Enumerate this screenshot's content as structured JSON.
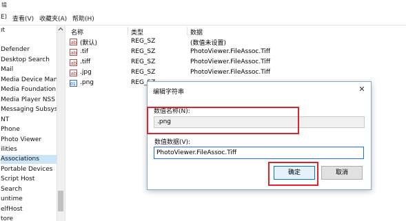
{
  "menubar": {
    "top_fragment": "辑",
    "items": [
      "E)",
      "查看(V)",
      "收藏夹(A)",
      "帮助(H)"
    ]
  },
  "tree": {
    "items": [
      {
        "label": "ıt",
        "selected": false
      },
      {
        "label": "Defender",
        "selected": false
      },
      {
        "label": "Desktop Search",
        "selected": false
      },
      {
        "label": "Mail",
        "selected": false
      },
      {
        "label": "Media Device Mana",
        "selected": false
      },
      {
        "label": "Media Foundation",
        "selected": false
      },
      {
        "label": "Media Player NSS",
        "selected": false
      },
      {
        "label": "Messaging Subsyst",
        "selected": false
      },
      {
        "label": "NT",
        "selected": false
      },
      {
        "label": "Phone",
        "selected": false
      },
      {
        "label": "Photo Viewer",
        "selected": false
      },
      {
        "label": "ilities",
        "selected": false
      },
      {
        "label": "Associations",
        "selected": true
      },
      {
        "label": "Portable Devices",
        "selected": false
      },
      {
        "label": "Script Host",
        "selected": false
      },
      {
        "label": "Search",
        "selected": false
      },
      {
        "label": "untime",
        "selected": false
      },
      {
        "label": "elfHost",
        "selected": false
      },
      {
        "label": "tore",
        "selected": false
      }
    ]
  },
  "list": {
    "headers": {
      "name": "名称",
      "type": "类型",
      "data": "数据"
    },
    "rows": [
      {
        "name": "(默认)",
        "type": "REG_SZ",
        "data": "(数值未设置)"
      },
      {
        "name": ".tif",
        "type": "REG_SZ",
        "data": "PhotoViewer.FileAssoc.Tiff"
      },
      {
        "name": ".tiff",
        "type": "REG_SZ",
        "data": "PhotoViewer.FileAssoc.Tiff"
      },
      {
        "name": ".jpg",
        "type": "REG_SZ",
        "data": "PhotoViewer.FileAssoc.Tiff"
      },
      {
        "name": ".png",
        "type": "REG_SZ",
        "data": ""
      }
    ]
  },
  "dialog": {
    "title": "编辑字符串",
    "close_glyph": "✕",
    "name_label": "数值名称(N):",
    "name_value": ".png",
    "data_label": "数值数据(V):",
    "data_value": "PhotoViewer.FileAssoc.Tiff",
    "ok_label": "确定",
    "cancel_label": "取消"
  },
  "colors": {
    "highlight_red": "#e0222b",
    "selection_blue": "#cce4f7",
    "focus_blue": "#1e6fd9"
  }
}
